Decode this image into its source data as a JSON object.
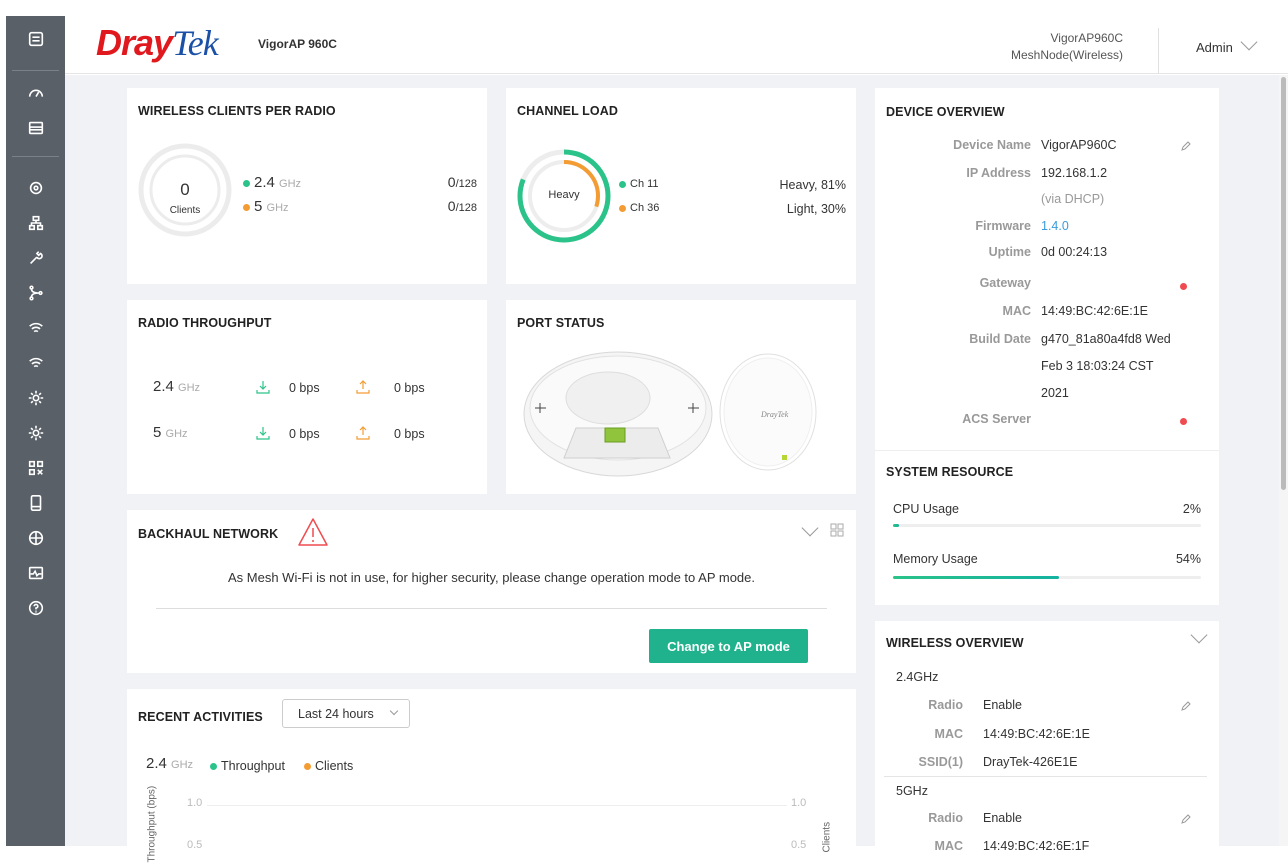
{
  "header": {
    "brand_dray": "Dray",
    "brand_tek": "Tek",
    "model": "VigorAP 960C",
    "device_name": "VigorAP960C",
    "device_mode": "MeshNode(Wireless)",
    "user": "Admin"
  },
  "sidebar": {
    "items": [
      "dashboard-icon",
      "monitor-icon",
      "refresh-icon",
      "network-icon",
      "tool-icon",
      "mesh-icon",
      "wifi-icon",
      "wifi-icon",
      "settings-icon",
      "settings-icon",
      "apps-icon",
      "mobile-icon",
      "globe-icon",
      "diagnostic-icon",
      "help-icon"
    ]
  },
  "wireless_clients": {
    "title": "WIRELESS CLIENTS PER RADIO",
    "total": "0",
    "total_label": "Clients",
    "radios": [
      {
        "band": "2.4",
        "unit": "GHz",
        "count": "0",
        "max": "/128",
        "color": "#2bc38a"
      },
      {
        "band": "5",
        "unit": "GHz",
        "count": "0",
        "max": "/128",
        "color": "#f39c34"
      }
    ]
  },
  "channel_load": {
    "title": "CHANNEL LOAD",
    "center": "Heavy",
    "channels": [
      {
        "name": "Ch 11",
        "status": "Heavy, 81%",
        "percent": 81,
        "color": "#2bc38a"
      },
      {
        "name": "Ch 36",
        "status": "Light, 30%",
        "percent": 30,
        "color": "#f39c34"
      }
    ]
  },
  "radio_throughput": {
    "title": "RADIO THROUGHPUT",
    "rows": [
      {
        "band": "2.4",
        "unit": "GHz",
        "down": "0 bps",
        "up": "0 bps"
      },
      {
        "band": "5",
        "unit": "GHz",
        "down": "0 bps",
        "up": "0 bps"
      }
    ]
  },
  "port_status": {
    "title": "PORT STATUS",
    "logo": "DrayTek"
  },
  "backhaul": {
    "title": "BACKHAUL NETWORK",
    "message": "As Mesh Wi-Fi is not in use, for higher security, please change operation mode to AP mode.",
    "button": "Change to AP mode"
  },
  "recent": {
    "title": "RECENT ACTIVITIES",
    "range": "Last 24 hours",
    "band": "2.4",
    "unit": "GHz",
    "legend_throughput": "Throughput",
    "legend_clients": "Clients",
    "y_top_left": "1.0",
    "y_top_right": "1.0",
    "y_mid_left": "0.5",
    "y_mid_right": "0.5",
    "ylabel_left": "Throughput (bps)",
    "ylabel_right": "Clients"
  },
  "device_overview": {
    "title": "DEVICE OVERVIEW",
    "device_name_label": "Device Name",
    "device_name": "VigorAP960C",
    "ip_label": "IP Address",
    "ip": "192.168.1.2",
    "ip_note": "(via DHCP)",
    "fw_label": "Firmware",
    "fw": "1.4.0",
    "uptime_label": "Uptime",
    "uptime": "0d 00:24:13",
    "gw_label": "Gateway",
    "mac_label": "MAC",
    "mac": "14:49:BC:42:6E:1E",
    "build_label": "Build Date",
    "build_1": "g470_81a80a4fd8 Wed",
    "build_2": "Feb 3 18:03:24 CST",
    "build_3": "2021",
    "acs_label": "ACS Server"
  },
  "system_resource": {
    "title": "SYSTEM RESOURCE",
    "cpu_label": "CPU Usage",
    "cpu": "2%",
    "cpu_frac": 0.02,
    "mem_label": "Memory Usage",
    "mem": "54%",
    "mem_frac": 0.54
  },
  "wireless_overview": {
    "title": "WIRELESS OVERVIEW",
    "band1": "2.4GHz",
    "radio_label": "Radio",
    "radio1": "Enable",
    "mac_label": "MAC",
    "mac1": "14:49:BC:42:6E:1E",
    "ssid_label": "SSID(1)",
    "ssid1": "DrayTek-426E1E",
    "band2": "5GHz",
    "radio2": "Enable",
    "mac2": "14:49:BC:42:6E:1F"
  }
}
